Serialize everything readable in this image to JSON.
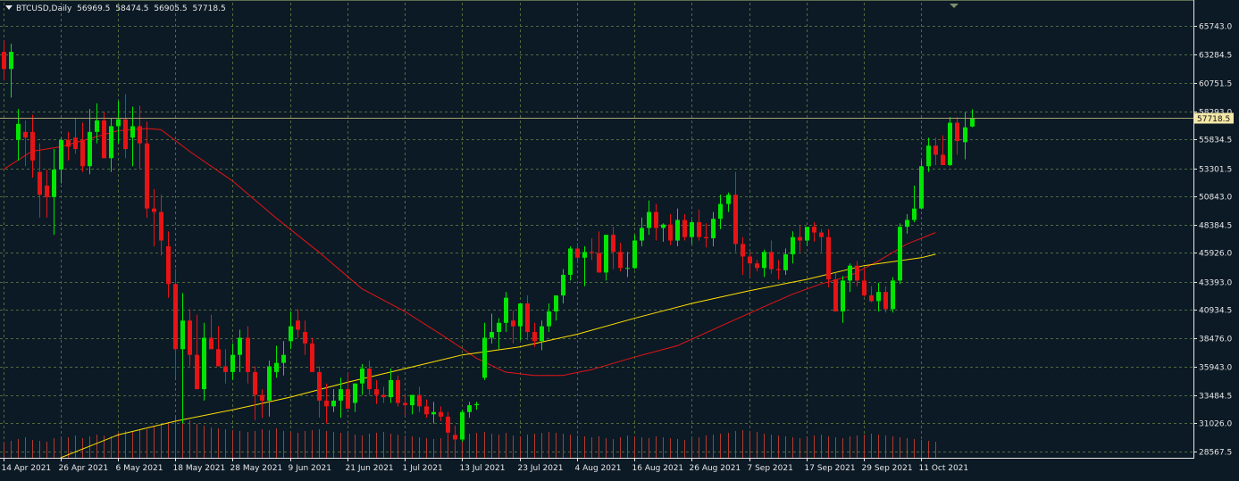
{
  "header": {
    "symbol": "BTCUSD,Daily",
    "open": "56969.5",
    "high": "58474.5",
    "low": "56905.5",
    "close": "57718.5"
  },
  "colors": {
    "background": "#0c1a26",
    "grid": "#4f6a3a",
    "axis_text": "#e6e6e6",
    "bull": "#00e600",
    "bear": "#e61414",
    "ma_fast": "#e61414",
    "ma_slow": "#ffdf00",
    "volume": "#b03a2e",
    "price_line": "#a8a070",
    "price_label_bg": "#f2e7a6"
  },
  "chart_data": {
    "type": "candlestick",
    "title": "BTCUSD,Daily",
    "ohlc_header": {
      "open": 56969.5,
      "high": 58474.5,
      "low": 56905.5,
      "close": 57718.5
    },
    "current_price": 57718.5,
    "current_price_label": "57718.5",
    "ylim": [
      28000,
      67800
    ],
    "y_ticks": [
      65743.0,
      63284.5,
      60751.5,
      58293.0,
      55834.5,
      53301.5,
      50843.0,
      48384.5,
      45926.0,
      43393.0,
      40934.5,
      38476.0,
      35943.0,
      33484.5,
      31026.0,
      28567.5
    ],
    "y_tick_labels": [
      "65743.0",
      "63284.5",
      "60751.5",
      "58293.0",
      "55834.5",
      "53301.5",
      "50843.0",
      "48384.5",
      "45926.0",
      "43393.0",
      "40934.5",
      "38476.0",
      "35943.0",
      "33484.5",
      "31026.0",
      "28567.5"
    ],
    "x_tick_labels": [
      "14 Apr 2021",
      "26 Apr 2021",
      "6 May 2021",
      "18 May 2021",
      "28 May 2021",
      "9 Jun 2021",
      "21 Jun 2021",
      "1 Jul 2021",
      "13 Jul 2021",
      "23 Jul 2021",
      "4 Aug 2021",
      "16 Aug 2021",
      "26 Aug 2021",
      "7 Sep 2021",
      "17 Sep 2021",
      "29 Sep 2021",
      "11 Oct 2021"
    ],
    "x_tick_bar_index": [
      0,
      8,
      16,
      24,
      32,
      40,
      48,
      56,
      64,
      72,
      80,
      88,
      96,
      104,
      112,
      120,
      128
    ],
    "grid": true,
    "candles": [
      [
        63500,
        64500,
        61000,
        62000
      ],
      [
        62000,
        64200,
        59500,
        63500
      ],
      [
        55800,
        58500,
        54000,
        57200
      ],
      [
        56500,
        57500,
        53500,
        56000
      ],
      [
        56500,
        58000,
        52500,
        54000
      ],
      [
        53000,
        55500,
        49000,
        51000
      ],
      [
        51800,
        53200,
        49000,
        50800
      ],
      [
        50800,
        55000,
        47500,
        53200
      ],
      [
        53200,
        56000,
        52000,
        55800
      ],
      [
        55800,
        56500,
        54000,
        55200
      ],
      [
        56000,
        57700,
        54600,
        55000
      ],
      [
        55800,
        57300,
        53000,
        53500
      ],
      [
        53500,
        58500,
        52800,
        56500
      ],
      [
        56500,
        59000,
        55500,
        57500
      ],
      [
        57500,
        58200,
        55000,
        54200
      ],
      [
        54200,
        57700,
        53000,
        57000
      ],
      [
        57000,
        59200,
        55500,
        57600
      ],
      [
        57600,
        59800,
        54200,
        55000
      ],
      [
        56000,
        58700,
        53500,
        57000
      ],
      [
        57000,
        58800,
        53200,
        55500
      ],
      [
        55500,
        57400,
        49000,
        49800
      ],
      [
        49800,
        51500,
        46500,
        49500
      ],
      [
        49500,
        51000,
        45700,
        47000
      ],
      [
        46500,
        47800,
        42000,
        43200
      ],
      [
        43200,
        44500,
        35000,
        37500
      ],
      [
        37500,
        42400,
        31000,
        40000
      ],
      [
        40000,
        41000,
        36000,
        37000
      ],
      [
        37000,
        40500,
        34000,
        34000
      ],
      [
        34000,
        39800,
        33000,
        38500
      ],
      [
        38500,
        40500,
        37500,
        37500
      ],
      [
        37500,
        39500,
        36000,
        36000
      ],
      [
        36000,
        37500,
        34500,
        35500
      ],
      [
        35500,
        38000,
        34800,
        37000
      ],
      [
        37000,
        39200,
        35500,
        38500
      ],
      [
        38500,
        39500,
        34500,
        35500
      ],
      [
        35500,
        36000,
        31300,
        33500
      ],
      [
        33500,
        34000,
        31500,
        33000
      ],
      [
        33000,
        36500,
        31600,
        36000
      ],
      [
        35500,
        37800,
        35000,
        36300
      ],
      [
        36300,
        38200,
        35200,
        37000
      ],
      [
        38200,
        40800,
        37500,
        39500
      ],
      [
        40000,
        41000,
        38500,
        39200
      ],
      [
        39000,
        40000,
        37000,
        38000
      ],
      [
        38000,
        38500,
        36000,
        35500
      ],
      [
        35500,
        36000,
        31500,
        33000
      ],
      [
        33000,
        34500,
        31000,
        32500
      ],
      [
        32500,
        34000,
        32000,
        33000
      ],
      [
        33000,
        35000,
        31500,
        34000
      ],
      [
        34000,
        35500,
        32800,
        32300
      ],
      [
        32800,
        34500,
        32000,
        34500
      ],
      [
        34500,
        36200,
        33500,
        35800
      ],
      [
        35800,
        36500,
        33500,
        34000
      ],
      [
        34000,
        34800,
        32700,
        33500
      ],
      [
        33500,
        34200,
        32800,
        33300
      ],
      [
        33300,
        35800,
        32800,
        34800
      ],
      [
        34800,
        35200,
        32500,
        32800
      ],
      [
        32800,
        33500,
        31700,
        32600
      ],
      [
        32600,
        33500,
        31800,
        33500
      ],
      [
        33500,
        34200,
        32000,
        32500
      ],
      [
        32500,
        33100,
        31500,
        31800
      ],
      [
        31800,
        32900,
        31000,
        32000
      ],
      [
        32000,
        32500,
        31200,
        31600
      ],
      [
        31600,
        32000,
        29500,
        30200
      ],
      [
        30000,
        30800,
        29200,
        29600
      ],
      [
        29600,
        32200,
        29400,
        32000
      ],
      [
        32000,
        32900,
        31500,
        32600
      ],
      [
        32600,
        32900,
        32200,
        32700
      ],
      [
        35000,
        39800,
        34800,
        38500
      ],
      [
        38500,
        40600,
        38000,
        39000
      ],
      [
        39000,
        40200,
        37500,
        39800
      ],
      [
        39800,
        42500,
        39000,
        42000
      ],
      [
        40000,
        40900,
        38000,
        39500
      ],
      [
        39500,
        41200,
        38300,
        41500
      ],
      [
        41500,
        42200,
        38300,
        39000
      ],
      [
        39000,
        39800,
        37700,
        38200
      ],
      [
        38200,
        40000,
        37400,
        39500
      ],
      [
        39500,
        41500,
        39000,
        40800
      ],
      [
        40800,
        42200,
        40000,
        42200
      ],
      [
        42200,
        44500,
        41500,
        44000
      ],
      [
        44000,
        46500,
        43500,
        46300
      ],
      [
        46300,
        46800,
        45000,
        45500
      ],
      [
        45500,
        46500,
        43000,
        46000
      ],
      [
        46000,
        47200,
        45300,
        45900
      ],
      [
        45900,
        47800,
        45200,
        44200
      ],
      [
        44200,
        46800,
        43500,
        47500
      ],
      [
        47500,
        48200,
        44500,
        46000
      ],
      [
        46000,
        46800,
        44300,
        44600
      ],
      [
        44600,
        46000,
        43800,
        44600
      ],
      [
        44600,
        47500,
        44500,
        47000
      ],
      [
        47000,
        49000,
        46500,
        48100
      ],
      [
        48100,
        50500,
        47500,
        49500
      ],
      [
        49500,
        50200,
        47000,
        48100
      ],
      [
        48100,
        48500,
        46900,
        48400
      ],
      [
        48400,
        49300,
        46600,
        47000
      ],
      [
        47000,
        49800,
        46500,
        48800
      ],
      [
        48800,
        49300,
        47000,
        47300
      ],
      [
        47300,
        48800,
        46700,
        48600
      ],
      [
        48600,
        49700,
        47000,
        47300
      ],
      [
        47300,
        48500,
        46400,
        47200
      ],
      [
        47200,
        49500,
        46500,
        48900
      ],
      [
        48900,
        51000,
        48000,
        50200
      ],
      [
        50200,
        51200,
        49500,
        51000
      ],
      [
        51000,
        53000,
        46000,
        46700
      ],
      [
        46700,
        47300,
        44000,
        45600
      ],
      [
        45600,
        46000,
        43800,
        45000
      ],
      [
        45000,
        45300,
        44300,
        44600
      ],
      [
        44600,
        46200,
        43800,
        46000
      ],
      [
        46000,
        47000,
        44100,
        44500
      ],
      [
        44500,
        45300,
        43600,
        44400
      ],
      [
        44400,
        46300,
        44000,
        45800
      ],
      [
        45800,
        47800,
        45000,
        47300
      ],
      [
        47300,
        48300,
        46000,
        47000
      ],
      [
        47000,
        48100,
        46500,
        48200
      ],
      [
        48200,
        48600,
        46900,
        47700
      ],
      [
        47700,
        48000,
        46000,
        47300
      ],
      [
        47300,
        48000,
        42900,
        43600
      ],
      [
        43600,
        44200,
        40800,
        40800
      ],
      [
        40800,
        43900,
        39800,
        43500
      ],
      [
        43500,
        45000,
        42500,
        44800
      ],
      [
        44800,
        45200,
        43000,
        43500
      ],
      [
        43500,
        44500,
        42100,
        42200
      ],
      [
        42200,
        43000,
        41600,
        41700
      ],
      [
        41700,
        43300,
        40800,
        42500
      ],
      [
        42500,
        43000,
        40700,
        41000
      ],
      [
        41000,
        43800,
        40700,
        43500
      ],
      [
        43500,
        48500,
        43200,
        48200
      ],
      [
        48200,
        49300,
        47600,
        48800
      ],
      [
        48800,
        51800,
        48600,
        49800
      ],
      [
        49800,
        54000,
        49700,
        53500
      ],
      [
        53500,
        56000,
        53000,
        55300
      ],
      [
        55300,
        56000,
        53600,
        54500
      ],
      [
        54500,
        56200,
        53600,
        53600
      ],
      [
        53600,
        57800,
        53500,
        57300
      ],
      [
        57300,
        57800,
        54500,
        55700
      ],
      [
        55600,
        58200,
        54100,
        56900
      ],
      [
        56969.5,
        58474.5,
        56905.5,
        57718.5
      ]
    ],
    "ma_slow": {
      "label": "",
      "first_bar": 8,
      "points": [
        [
          8,
          28000
        ],
        [
          16,
          30000
        ],
        [
          24,
          31200
        ],
        [
          32,
          32200
        ],
        [
          40,
          33300
        ],
        [
          48,
          34600
        ],
        [
          56,
          35800
        ],
        [
          64,
          37000
        ],
        [
          72,
          37700
        ],
        [
          80,
          38800
        ],
        [
          88,
          40200
        ],
        [
          96,
          41500
        ],
        [
          104,
          42600
        ],
        [
          112,
          43600
        ],
        [
          120,
          44800
        ],
        [
          128,
          45500
        ],
        [
          130,
          45800
        ]
      ]
    },
    "ma_fast": {
      "label": "",
      "points": [
        [
          0,
          53200
        ],
        [
          4,
          54800
        ],
        [
          8,
          55200
        ],
        [
          12,
          55900
        ],
        [
          16,
          56600
        ],
        [
          20,
          56800
        ],
        [
          22,
          56700
        ],
        [
          26,
          54800
        ],
        [
          32,
          52200
        ],
        [
          38,
          49000
        ],
        [
          44,
          46000
        ],
        [
          50,
          42800
        ],
        [
          56,
          40800
        ],
        [
          62,
          38400
        ],
        [
          66,
          36700
        ],
        [
          70,
          35500
        ],
        [
          74,
          35200
        ],
        [
          78,
          35200
        ],
        [
          82,
          35700
        ],
        [
          88,
          36800
        ],
        [
          94,
          37800
        ],
        [
          100,
          39500
        ],
        [
          106,
          41200
        ],
        [
          110,
          42300
        ],
        [
          114,
          43200
        ],
        [
          118,
          43900
        ],
        [
          122,
          45200
        ],
        [
          126,
          46700
        ],
        [
          130,
          47700
        ]
      ]
    },
    "volume": [
      18,
      19,
      21,
      23,
      20,
      19,
      18,
      22,
      24,
      23,
      25,
      22,
      24,
      26,
      25,
      24,
      28,
      30,
      29,
      31,
      32,
      35,
      38,
      40,
      45,
      48,
      42,
      38,
      36,
      34,
      33,
      32,
      31,
      30,
      29,
      30,
      32,
      31,
      33,
      30,
      29,
      28,
      30,
      31,
      32,
      30,
      29,
      28,
      27,
      26,
      25,
      27,
      28,
      29,
      27,
      26,
      25,
      24,
      23,
      22,
      21,
      22,
      23,
      24,
      26,
      27,
      28,
      29,
      27,
      26,
      28,
      25,
      24,
      26,
      27,
      28,
      29,
      28,
      27,
      26,
      25,
      24,
      23,
      24,
      22,
      21,
      23,
      25,
      24,
      23,
      22,
      24,
      23,
      22,
      21,
      20,
      22,
      23,
      25,
      26,
      27,
      28,
      30,
      31,
      30,
      29,
      27,
      26,
      25,
      24,
      23,
      22,
      24,
      25,
      26,
      24,
      23,
      22,
      24,
      25,
      26,
      27,
      26,
      25,
      24,
      23,
      22,
      21,
      20,
      19,
      18
    ]
  }
}
